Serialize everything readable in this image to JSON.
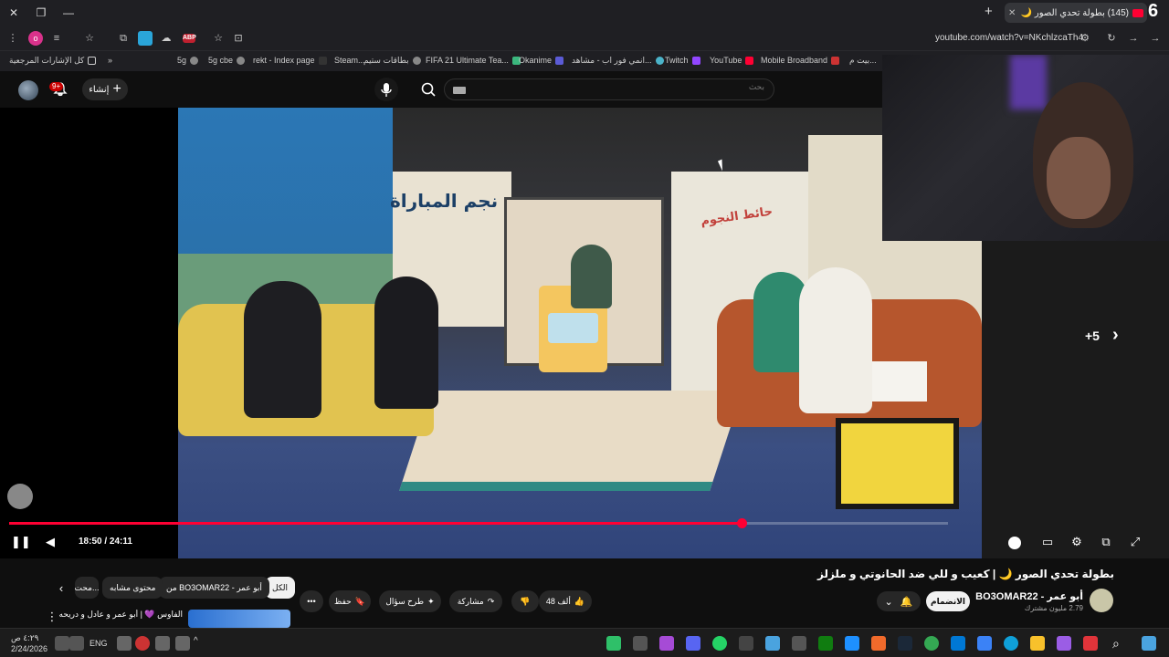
{
  "browser": {
    "tab_title": "(145) بطولة تحدي الصور 🌙",
    "url": "youtube.com/watch?v=NKchlzcaTh4",
    "corner_number": "6",
    "bookmarks": [
      {
        "label": "كل الإشارات المرجعية"
      },
      {
        "label": "5g"
      },
      {
        "label": "5g cbe"
      },
      {
        "label": "rekt - Index page"
      },
      {
        "label": "Steam..."
      },
      {
        "label": "بطاقات ستيم"
      },
      {
        "label": "FIFA 21 Ultimate Tea..."
      },
      {
        "label": "Okanime"
      },
      {
        "label": "انمي فور اب - مشاهد..."
      },
      {
        "label": "Twitch"
      },
      {
        "label": "YouTube"
      },
      {
        "label": "Mobile Broadband"
      },
      {
        "label": "بيت م..."
      }
    ]
  },
  "youtube_header": {
    "create_label": "إنشاء",
    "notif_count": "9+",
    "search_placeholder": "بحث"
  },
  "video": {
    "sign_left": "نجم المباراة",
    "sign_right": "حائط النجوم",
    "current_time": "18:50 / 24:11",
    "progress": 0.78,
    "next_count": "+5"
  },
  "below": {
    "title": "بطولة تحدي الصور 🌙 | كعيب و للي ضد الحانوتي و ملزلز",
    "channel_name": "أبو عمر - BO3OMAR22",
    "subs": "2.79 مليون مشترك",
    "join_label": "الانضمام",
    "likes": "48 ألف",
    "share_label": "مشاركة",
    "ask_label": "طرح سؤال",
    "save_label": "حفظ",
    "chips": [
      {
        "label": "الكل"
      },
      {
        "label": "من BO3OMAR22 - أبو عمر"
      },
      {
        "label": "محتوى مشابه"
      },
      {
        "label": "محت..."
      }
    ],
    "rec_title": "الفاوس 💜 | أبو عمر و عادل و دريحه"
  },
  "taskbar": {
    "lang": "ENG",
    "time": "٤:٢٩ ص",
    "date": "2/24/2026"
  }
}
